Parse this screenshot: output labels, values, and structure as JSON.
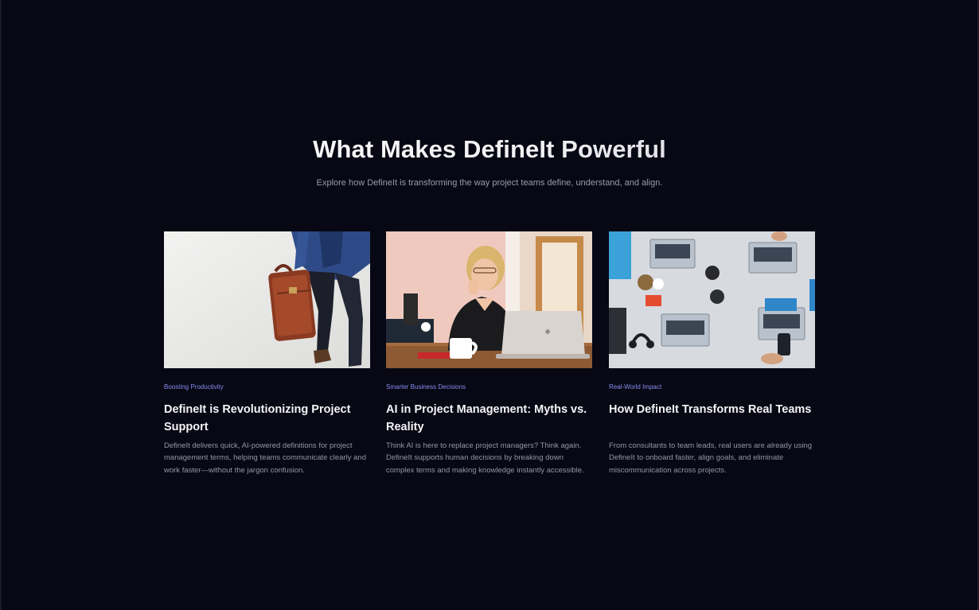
{
  "section": {
    "title": "What Makes DefineIt Powerful",
    "subtitle": "Explore how DefineIt is transforming the way project teams define, understand, and align."
  },
  "cards": [
    {
      "image": "man-walking-with-briefcase-photo",
      "category": "Boosting Productivity",
      "title": "DefineIt is Revolutionizing Project Support",
      "text": "DefineIt delivers quick, AI-powered definitions for project management terms, helping teams communicate clearly and work faster—without the jargon confusion."
    },
    {
      "image": "woman-thinking-at-laptop-photo",
      "category": "Smarter Business Decisions",
      "title": "AI in Project Management: Myths vs. Reality",
      "text": "Think AI is here to replace project managers? Think again. DefineIt supports human decisions by breaking down complex terms and making knowledge instantly accessible."
    },
    {
      "image": "team-laptops-overhead-photo",
      "category": "Real-World Impact",
      "title": "How DefineIt Transforms Real Teams",
      "text": "From consultants to team leads, real users are already using DefineIt to onboard faster, align goals, and eliminate miscommunication across projects."
    }
  ],
  "colors": {
    "background": "#070814",
    "category_accent": "#8a8cf0",
    "body_text": "#9597a6",
    "title_text": "#f4f4f7"
  }
}
